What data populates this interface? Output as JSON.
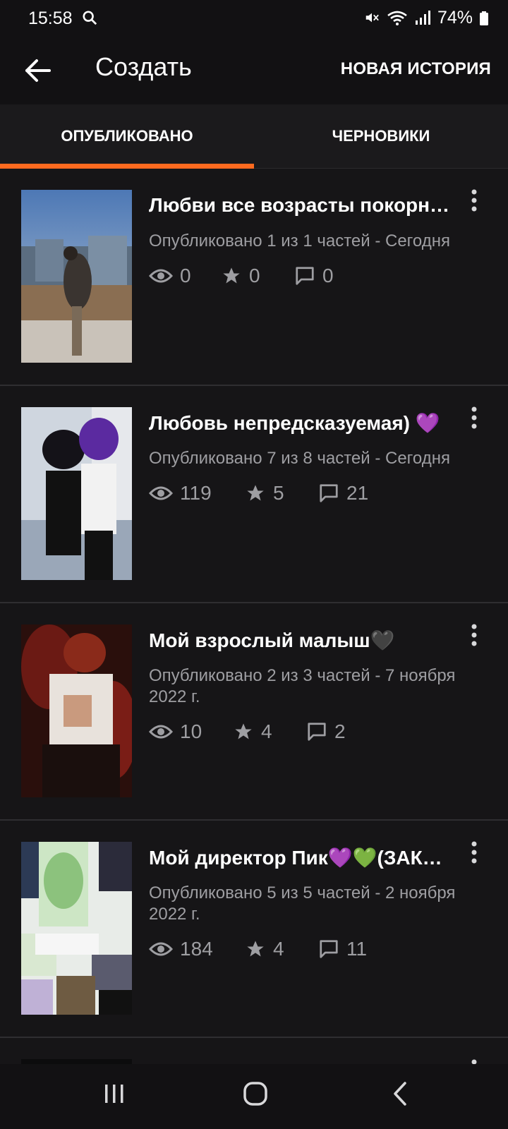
{
  "status_bar": {
    "time": "15:58",
    "battery": "74%"
  },
  "app_bar": {
    "title": "Создать",
    "new_story": "НОВАЯ ИСТОРИЯ"
  },
  "tabs": [
    {
      "label": "ОПУБЛИКОВАНО",
      "selected": true
    },
    {
      "label": "ЧЕРНОВИКИ",
      "selected": false
    }
  ],
  "accent_color": "#ff6a1f",
  "stories": [
    {
      "title": "Любви все возрасты покорн…",
      "meta": "Опубликовано 1 из 1 частей - Сегодня",
      "views": "0",
      "votes": "0",
      "comments": "0"
    },
    {
      "title": "Любовь непредсказуемая) 💜",
      "meta": "Опубликовано 7 из 8 частей - Сегодня",
      "views": "119",
      "votes": "5",
      "comments": "21"
    },
    {
      "title": "Мой взрослый малыш🖤",
      "meta": "Опубликовано 2 из 3 частей - 7 ноября 2022 г.",
      "views": "10",
      "votes": "4",
      "comments": "2"
    },
    {
      "title": "Мой директор Пик💜💚(ЗАК…",
      "meta": "Опубликовано 5 из 5 частей - 2 ноября 2022 г.",
      "views": "184",
      "votes": "4",
      "comments": "11"
    }
  ],
  "icons": {
    "back": "arrow-left-icon",
    "search": "search-icon",
    "views": "eye-icon",
    "votes": "star-icon",
    "comments": "comment-icon",
    "menu": "more-vertical-icon"
  }
}
